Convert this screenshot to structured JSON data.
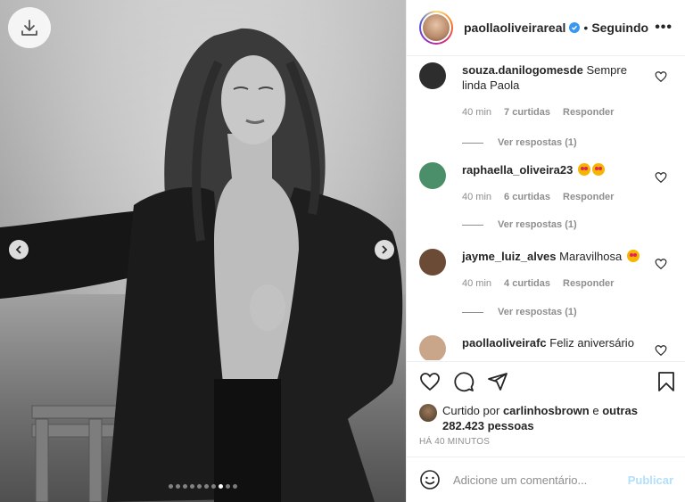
{
  "post": {
    "author": "paollaoliveirareal",
    "separator": "•",
    "follow_status": "Seguindo",
    "more_label": "•••",
    "carousel_total": 10,
    "carousel_index": 8
  },
  "comments": [
    {
      "user": "souza.danilogomesde",
      "text": "Sempre linda Paola",
      "time": "40 min",
      "likes": "7 curtidas",
      "reply": "Responder",
      "view_replies": "Ver respostas (1)",
      "avatar_color": "#3a3a3a"
    },
    {
      "user": "raphaella_oliveira23",
      "text": "",
      "emojis": 2,
      "time": "40 min",
      "likes": "6 curtidas",
      "reply": "Responder",
      "view_replies": "Ver respostas (1)",
      "avatar_color": "#4a8f6a"
    },
    {
      "user": "jayme_luiz_alves",
      "text": "Maravilhosa",
      "emojis": 1,
      "time": "40 min",
      "likes": "4 curtidas",
      "reply": "Responder",
      "view_replies": "Ver respostas (1)",
      "avatar_color": "#6b4a36"
    },
    {
      "user": "paollaoliveirafc",
      "text": "Feliz aniversário",
      "avatar_color": "#c9a58a"
    }
  ],
  "liked_by": {
    "prefix": "Curtido por",
    "user": "carlinhosbrown",
    "conj": "e",
    "others": "outras 282.423 pessoas"
  },
  "timestamp": "HÁ 40 MINUTOS",
  "comment_box": {
    "placeholder": "Adicione um comentário...",
    "publish_label": "Publicar"
  },
  "colors": {
    "link_blue": "#3897f0",
    "publish_disabled": "#b2dffc",
    "muted": "#8e8e8e"
  }
}
